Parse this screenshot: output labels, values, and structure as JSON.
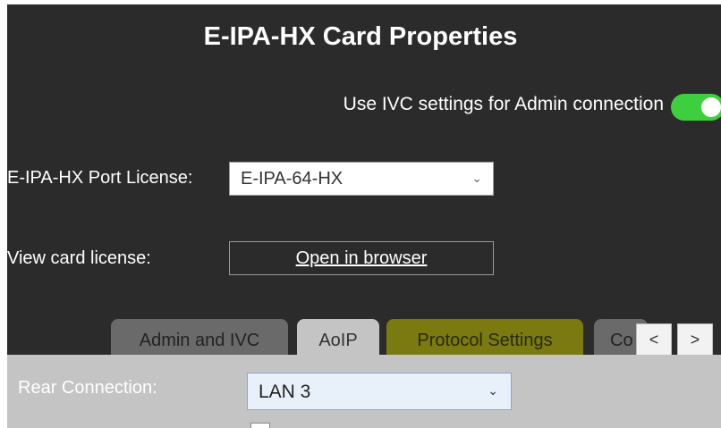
{
  "dialog": {
    "title": "E-IPA-HX Card Properties"
  },
  "ivc_toggle": {
    "label": "Use IVC settings for Admin connection",
    "on": true
  },
  "port_license": {
    "label": "E-IPA-HX Port License:",
    "value": "E-IPA-64-HX"
  },
  "card_license": {
    "label": "View card license:",
    "button": "Open in browser"
  },
  "tabs": [
    {
      "label": "Admin and IVC",
      "active": false
    },
    {
      "label": "AoIP",
      "active": true
    },
    {
      "label": "Protocol Settings",
      "active": false
    },
    {
      "label": "Co",
      "active": false
    }
  ],
  "tab_nav": {
    "prev": "<",
    "next": ">"
  },
  "aoip": {
    "rear_connection_label": "Rear Connection:",
    "rear_connection_value": "LAN 3"
  },
  "colors": {
    "panel": "#2b2b2b",
    "toggle_on": "#3ecf3e",
    "protocol_tab": "#7a7a10"
  }
}
